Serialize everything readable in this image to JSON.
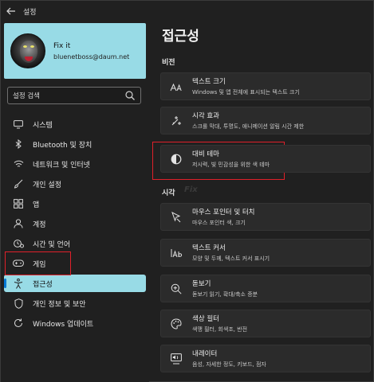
{
  "window": {
    "title": "설정"
  },
  "profile": {
    "name": "Fix it",
    "email": "bluenetboss@daum.net"
  },
  "search": {
    "value": "설정 검색"
  },
  "nav": {
    "items": [
      {
        "label": "시스템",
        "icon": "monitor-icon"
      },
      {
        "label": "Bluetooth 및 장치",
        "icon": "bluetooth-icon"
      },
      {
        "label": "네트워크 및 인터넷",
        "icon": "wifi-icon"
      },
      {
        "label": "개인 설정",
        "icon": "brush-icon"
      },
      {
        "label": "앱",
        "icon": "apps-icon"
      },
      {
        "label": "계정",
        "icon": "person-icon"
      },
      {
        "label": "시간 및 언어",
        "icon": "clock-globe-icon"
      },
      {
        "label": "게임",
        "icon": "gamepad-icon"
      },
      {
        "label": "접근성",
        "icon": "accessibility-icon"
      },
      {
        "label": "개인 정보 및 보안",
        "icon": "shield-icon"
      },
      {
        "label": "Windows 업데이트",
        "icon": "update-icon"
      }
    ],
    "selected": "접근성"
  },
  "main": {
    "title": "접근성",
    "sections": [
      {
        "label": "비전",
        "cards": [
          {
            "title": "텍스트 크기",
            "desc": "Windows 및 앱 전체에 표시되는 텍스트 크기",
            "icon": "text-size-icon"
          },
          {
            "title": "시각 효과",
            "desc": "스크롤 막대, 투명도, 애니메이션 알림 시간 제한",
            "icon": "sparkle-icon"
          },
          {
            "title": "대비 테마",
            "desc": "저시력, 빛 민감성을 위한 색 테마",
            "icon": "contrast-icon"
          }
        ]
      },
      {
        "label": "시각",
        "cards": [
          {
            "title": "마우스 포인터 및 터치",
            "desc": "마우스 포인터 색, 크기",
            "icon": "pointer-icon"
          },
          {
            "title": "텍스트 커서",
            "desc": "모양 및 두께, 텍스트 커서 표시기",
            "icon": "text-cursor-icon"
          },
          {
            "title": "돋보기",
            "desc": "돋보기 읽기, 확대/축소 증분",
            "icon": "magnifier-icon"
          },
          {
            "title": "색상 필터",
            "desc": "색맹 필터, 회색조, 반전",
            "icon": "color-filter-icon"
          },
          {
            "title": "내레이터",
            "desc": "음성, 자세한 정도, 키보드, 점자",
            "icon": "narrator-icon"
          }
        ]
      }
    ]
  },
  "watermark": "Fix",
  "colors": {
    "accent": "#98dbe6",
    "highlight": "#e0202a",
    "background": "#202020",
    "card": "#2b2b2b"
  }
}
